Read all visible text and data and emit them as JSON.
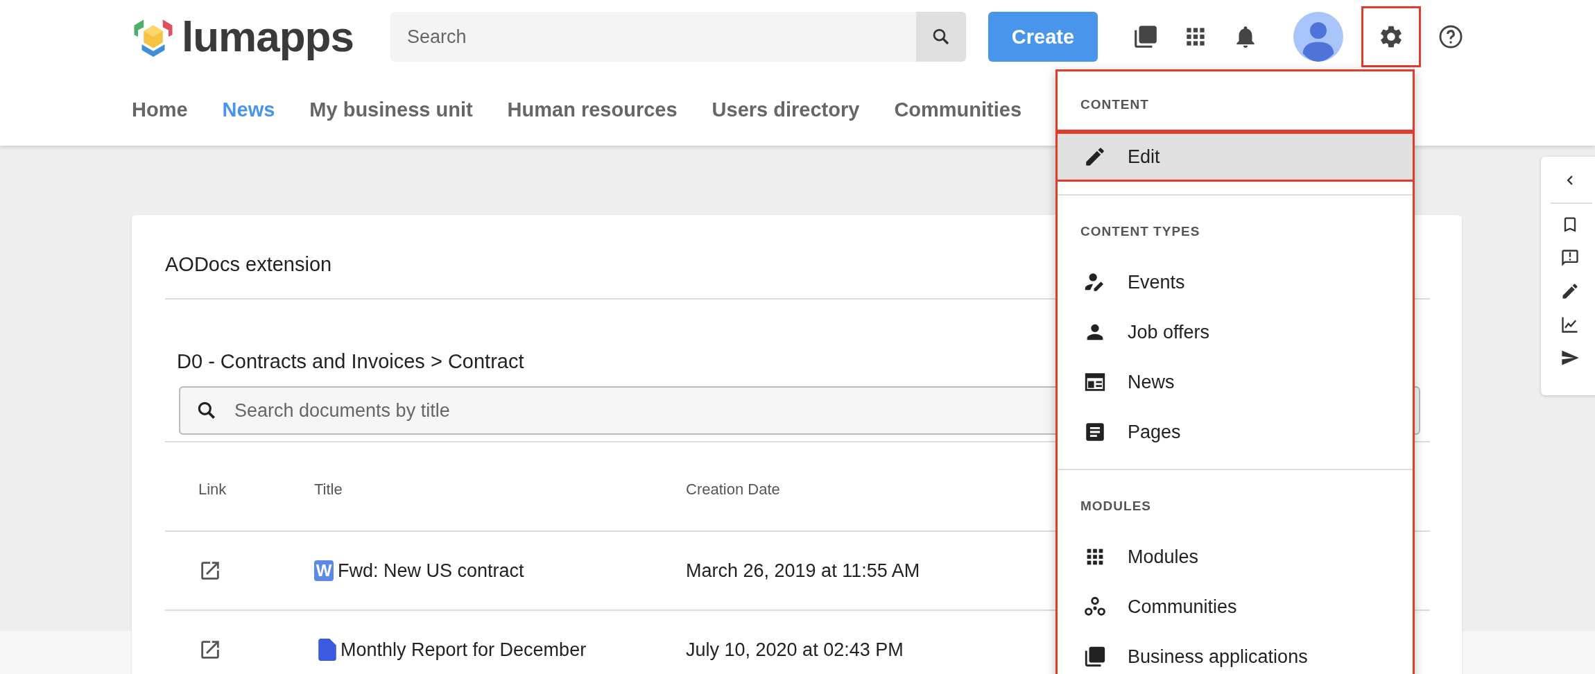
{
  "header": {
    "brand": "lumapps",
    "search": {
      "placeholder": "Search"
    },
    "create_button": "Create",
    "settings_outlined": true
  },
  "nav": [
    {
      "label": "Home",
      "selected": false
    },
    {
      "label": "News",
      "selected": true
    },
    {
      "label": "My business unit",
      "selected": false
    },
    {
      "label": "Human resources",
      "selected": false
    },
    {
      "label": "Users directory",
      "selected": false
    },
    {
      "label": "Communities",
      "selected": false
    }
  ],
  "card": {
    "title": "AODocs extension",
    "breadcrumb": "D0 - Contracts and Invoices > Contract",
    "search": {
      "placeholder": "Search documents by title"
    },
    "columns": [
      "Link",
      "Title",
      "Creation Date"
    ],
    "rows": [
      {
        "kind": "word",
        "badge": "W",
        "title": "Fwd: New US contract",
        "created": "March 26, 2019 at 11:55 AM"
      },
      {
        "kind": "doc",
        "title": "Monthly Report for December",
        "created": "July 10, 2020 at 02:43 PM"
      }
    ]
  },
  "settings_menu": {
    "outlined": true,
    "sections": [
      {
        "heading": "CONTENT",
        "outlined": true,
        "items": [
          {
            "label": "Edit",
            "selected": true,
            "outlined": true
          }
        ]
      },
      {
        "heading": "CONTENT TYPES",
        "outlined": false,
        "items": [
          {
            "label": "Events",
            "selected": false,
            "outlined": false
          },
          {
            "label": "Job offers",
            "selected": false,
            "outlined": false
          },
          {
            "label": "News",
            "selected": false,
            "outlined": false
          },
          {
            "label": "Pages",
            "selected": false,
            "outlined": false
          }
        ]
      },
      {
        "heading": "MODULES",
        "outlined": false,
        "items": [
          {
            "label": "Modules",
            "selected": false,
            "outlined": false
          },
          {
            "label": "Communities",
            "selected": false,
            "outlined": false
          },
          {
            "label": "Business applications",
            "selected": false,
            "outlined": false
          }
        ]
      }
    ]
  }
}
